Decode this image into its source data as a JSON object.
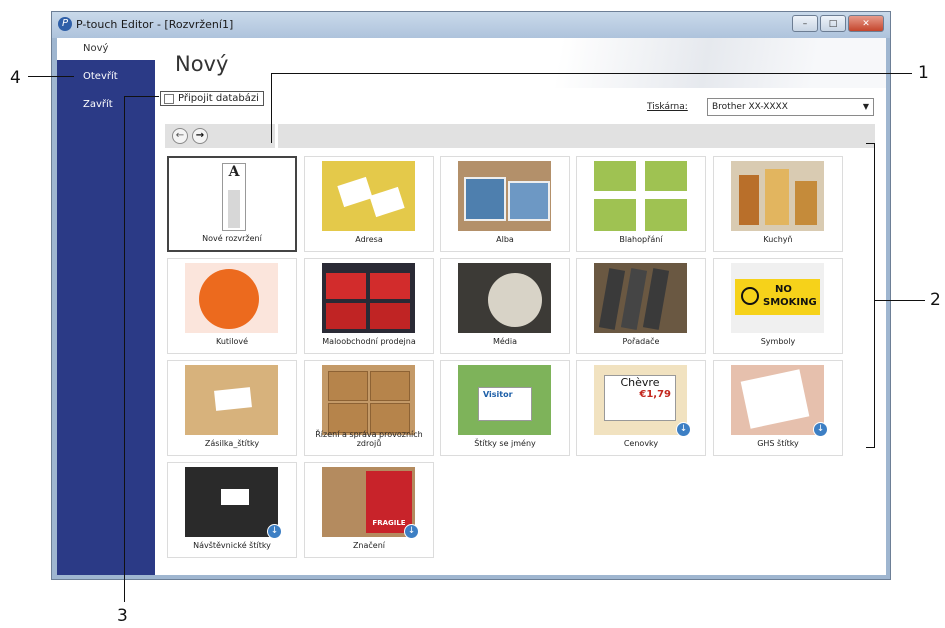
{
  "window": {
    "title": "P-touch Editor - [Rozvržení1]",
    "controls": {
      "minimize": "–",
      "maximize": "□",
      "close": "✕"
    }
  },
  "sidebar": {
    "items": [
      {
        "label": "Nový",
        "active": true
      },
      {
        "label": "Otevřít",
        "active": false
      },
      {
        "label": "Zavřít",
        "active": false
      }
    ]
  },
  "main": {
    "title": "Nový",
    "db_checkbox": {
      "label": "Připojit databázi",
      "checked": false
    },
    "printer": {
      "label": "Tiskárna:",
      "value": "Brother XX-XXXX"
    },
    "nav": {
      "back": "←",
      "forward": "→"
    }
  },
  "templates": [
    {
      "label": "Nové rozvržení",
      "selected": true
    },
    {
      "label": "Adresa"
    },
    {
      "label": "Alba"
    },
    {
      "label": "Blahopřání"
    },
    {
      "label": "Kuchyň"
    },
    {
      "label": "Kutilové"
    },
    {
      "label": "Maloobchodní prodejna"
    },
    {
      "label": "Média"
    },
    {
      "label": "Pořadače"
    },
    {
      "label": "Symboly",
      "sign": {
        "top": "NO",
        "bottom": "SMOKING"
      }
    },
    {
      "label": "Zásilka_štítky"
    },
    {
      "label": "Řízení a správa provozních zdrojů"
    },
    {
      "label": "Štítky se jmény",
      "badge": "Visitor"
    },
    {
      "label": "Cenovky",
      "download": true,
      "price_tag": {
        "name": "Chèvre",
        "price": "€1,79"
      }
    },
    {
      "label": "GHS štítky",
      "download": true
    },
    {
      "label": "Návštěvnické štítky",
      "download": true
    },
    {
      "label": "Značení",
      "download": true,
      "sign": "FRAGILE"
    }
  ],
  "blank_icon_letter": "A",
  "callouts": [
    "1",
    "2",
    "3",
    "4"
  ]
}
